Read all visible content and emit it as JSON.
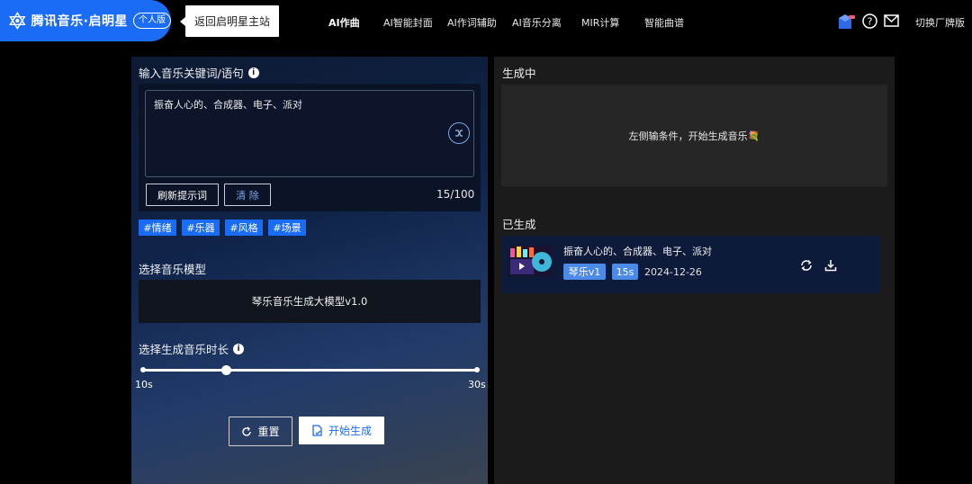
{
  "header": {
    "brand": "腾讯音乐·启明星",
    "edition_badge": "个人版",
    "back_label": "返回启明星主站",
    "nav": [
      {
        "label": "AI作曲",
        "active": true
      },
      {
        "label": "AI智能封面",
        "active": false
      },
      {
        "label": "AI作词辅助",
        "active": false
      },
      {
        "label": "AI音乐分离",
        "active": false
      },
      {
        "label": "MIR计算",
        "active": false
      },
      {
        "label": "智能曲谱",
        "active": false
      }
    ],
    "icons": [
      "gift-box-icon",
      "help-icon",
      "mail-icon"
    ],
    "switch_label": "切换厂牌版"
  },
  "left": {
    "prompt_label": "输入音乐关键词/语句",
    "prompt_value": "振奋人心的、合成器、电子、派对",
    "refresh_label": "刷新提示词",
    "clear_label": "清 除",
    "counter": "15/100",
    "tags": [
      "#情绪",
      "#乐器",
      "#风格",
      "#场景"
    ],
    "model_label": "选择音乐模型",
    "model_value": "琴乐音乐生成大模型v1.0",
    "duration_label": "选择生成音乐时长",
    "duration_min_label": "10s",
    "duration_max_label": "30s",
    "duration_min": 10,
    "duration_max": 30,
    "duration_value": 15,
    "reset_label": "重置",
    "start_label": "开始生成"
  },
  "right": {
    "generating_label": "生成中",
    "empty_hint": "左侧输条件，开始生成音乐💐",
    "generated_label": "已生成",
    "songs": [
      {
        "title": "振奋人心的、合成器、电子、派对",
        "model": "琴乐v1",
        "duration": "15s",
        "date": "2024-12-26"
      }
    ]
  },
  "colors": {
    "accent": "#1b6cf4",
    "chip": "#4c8ae8",
    "card": "#0d1a3a"
  }
}
